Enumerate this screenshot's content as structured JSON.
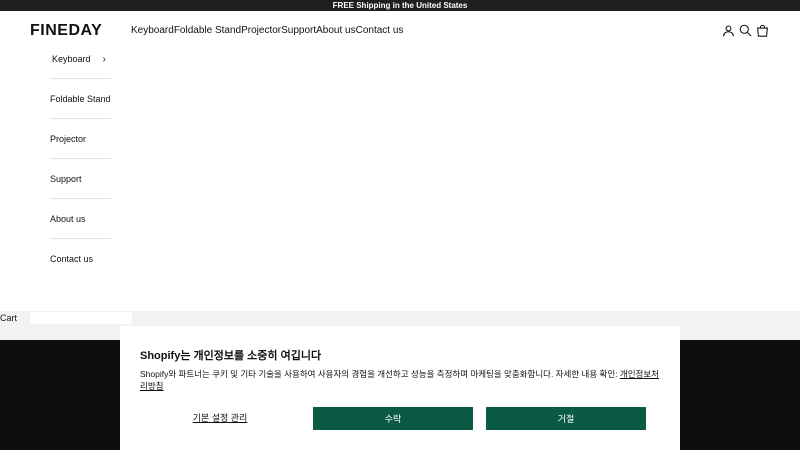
{
  "announcement": "FREE Shipping in the United States",
  "brand": "FINEDAY",
  "nav": [
    "Keyboard",
    "Foldable Stand",
    "Projector",
    "Support",
    "About us",
    "Contact us"
  ],
  "icons": {
    "account": "account-icon",
    "search": "search-icon",
    "cart": "cart-icon"
  },
  "dropdown": {
    "items": [
      "Keyboard",
      "Foldable Stand",
      "Projector",
      "Support",
      "About us",
      "Contact us"
    ],
    "chevron": "›"
  },
  "cart_label": "Cart",
  "consent": {
    "title": "Shopify는 개인정보를 소중히 여깁니다",
    "body": "Shopify와 파트너는 쿠키 및 기타 기술을 사용하여 사용자의 경험을 개선하고 성능을 측정하며 마케팅을 맞춤화합니다. 자세한 내용 확인: ",
    "link": "개인정보처리방침",
    "prefs": "기본 설정 관리",
    "accept": "수락",
    "decline": "거절",
    "button_color": "#0b5a45"
  }
}
